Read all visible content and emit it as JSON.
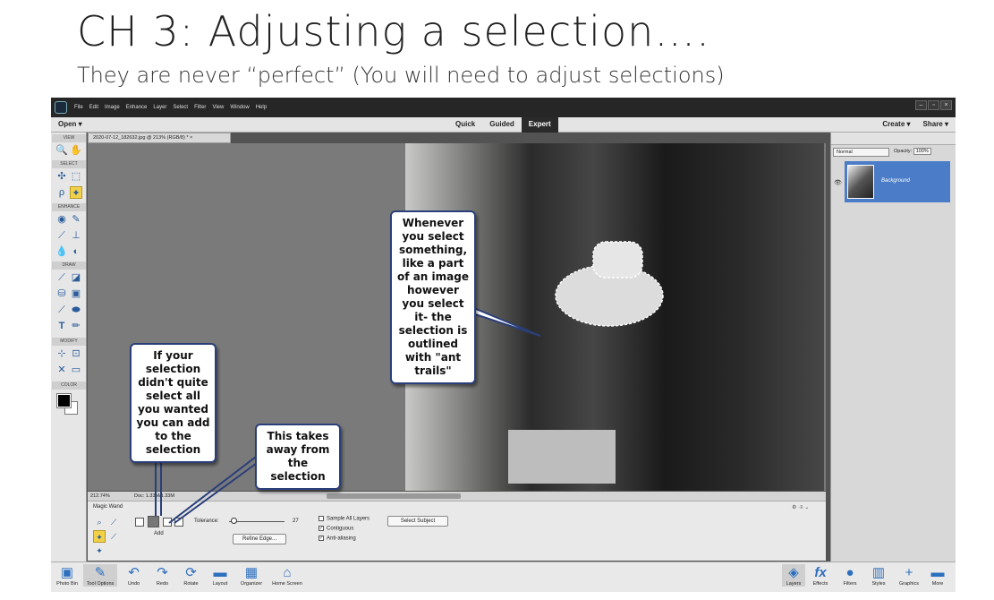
{
  "slide": {
    "title": "CH 3: Adjusting a selection….",
    "subtitle": "They are never “perfect” (You will need to adjust selections)"
  },
  "app": {
    "menu": [
      "File",
      "Edit",
      "Image",
      "Enhance",
      "Layer",
      "Select",
      "Filter",
      "View",
      "Window",
      "Help"
    ],
    "window_buttons": [
      "–",
      "▫",
      "×"
    ],
    "open_label": "Open",
    "mode_tabs": [
      "Quick",
      "Guided",
      "Expert"
    ],
    "active_mode": "Expert",
    "create_label": "Create",
    "share_label": "Share",
    "document_tab": "2020-07-12_182632.jpg @ 213% (RGB/8) *",
    "document_close": "×",
    "status_zoom": "212.74%",
    "status_doc": "Doc: 1.33M/1.33M"
  },
  "toolbar": {
    "sections": [
      "VIEW",
      "SELECT",
      "ENHANCE",
      "DRAW",
      "MODIFY",
      "COLOR"
    ],
    "tools": [
      {
        "name": "zoom-tool-icon",
        "glyph": "🔍"
      },
      {
        "name": "hand-tool-icon",
        "glyph": "✋"
      },
      {
        "name": "move-tool-icon",
        "glyph": "✣"
      },
      {
        "name": "marquee-tool-icon",
        "glyph": "⬚"
      },
      {
        "name": "lasso-tool-icon",
        "glyph": "ρ"
      },
      {
        "name": "magic-wand-tool-icon",
        "glyph": "✦"
      },
      {
        "name": "red-eye-tool-icon",
        "glyph": "◉"
      },
      {
        "name": "spot-healing-tool-icon",
        "glyph": "✎"
      },
      {
        "name": "smart-brush-tool-icon",
        "glyph": "⟋"
      },
      {
        "name": "clone-stamp-tool-icon",
        "glyph": "⊥"
      },
      {
        "name": "blur-tool-icon",
        "glyph": "💧"
      },
      {
        "name": "sponge-tool-icon",
        "glyph": "◐"
      },
      {
        "name": "brush-tool-icon",
        "glyph": "⟋"
      },
      {
        "name": "eraser-tool-icon",
        "glyph": "◪"
      },
      {
        "name": "paint-bucket-tool-icon",
        "glyph": "⛁"
      },
      {
        "name": "gradient-tool-icon",
        "glyph": "▣"
      },
      {
        "name": "eyedropper-tool-icon",
        "glyph": "⟋"
      },
      {
        "name": "shape-tool-icon",
        "glyph": "⬬"
      },
      {
        "name": "type-tool-icon",
        "glyph": "T"
      },
      {
        "name": "pencil-tool-icon",
        "glyph": "✏"
      },
      {
        "name": "crop-tool-icon",
        "glyph": "⊹"
      },
      {
        "name": "recompose-tool-icon",
        "glyph": "⊡"
      },
      {
        "name": "content-aware-move-tool-icon",
        "glyph": "✕"
      },
      {
        "name": "straighten-tool-icon",
        "glyph": "▭"
      }
    ]
  },
  "tool_options": {
    "tool_name": "Magic Wand",
    "add_label": "Add",
    "tolerance_label": "Tolerance:",
    "tolerance_value": "27",
    "refine_edge": "Refine Edge...",
    "sample_all_layers": "Sample All Layers",
    "contiguous": "Contiguous",
    "anti_aliasing": "Anti-aliasing",
    "select_subject": "Select Subject"
  },
  "layers_panel": {
    "blend_mode": "Normal",
    "opacity_label": "Opacity:",
    "opacity_value": "100%",
    "layer_name": "Background"
  },
  "bottom_left": [
    "Photo Bin",
    "Tool Options",
    "Undo",
    "Redo",
    "Rotate",
    "Layout",
    "Organizer",
    "Home Screen"
  ],
  "bottom_right": [
    "Layers",
    "Effects",
    "Filters",
    "Styles",
    "Graphics",
    "More"
  ],
  "callouts": {
    "selection": "Whenever you select something, like a part of an image however you select it- the selection is outlined with \"ant trails\"",
    "add": "If your selection didn't quite select all you wanted  you can add to the selection",
    "subtract": "This takes away from the selection"
  },
  "colors": {
    "accent": "#2d6fbf",
    "layer_selected": "#4a7cc7",
    "callout_border": "#2a3f7a",
    "active_tool": "#f2d14a"
  }
}
